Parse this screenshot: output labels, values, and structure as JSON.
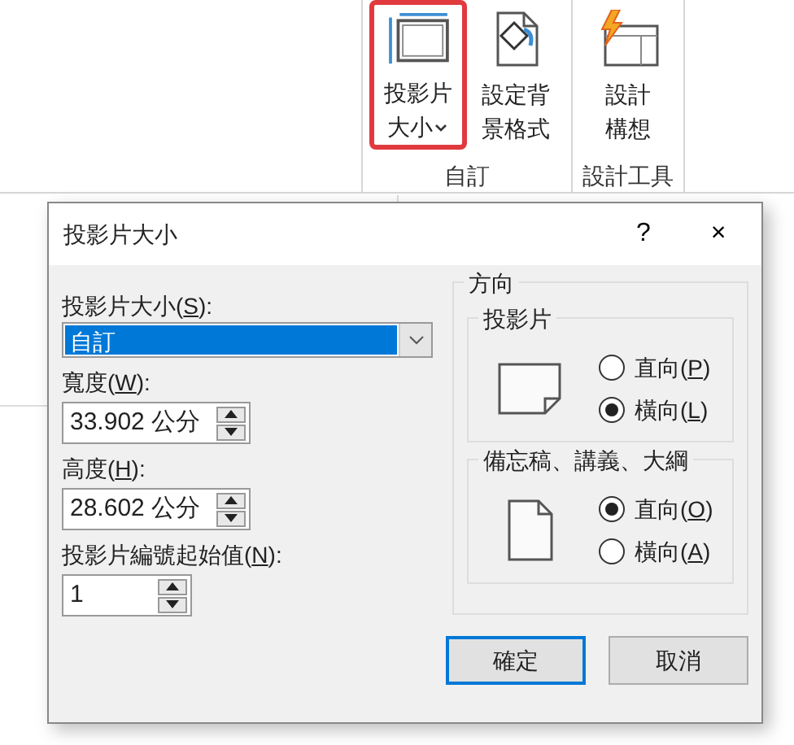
{
  "ribbon": {
    "groups": [
      {
        "label": "自訂",
        "buttons": [
          {
            "kind": "slide-size",
            "lines": [
              "投影片",
              "大小"
            ],
            "dropdown": true,
            "selected": true
          },
          {
            "kind": "background",
            "lines": [
              "設定背",
              "景格式"
            ],
            "dropdown": false,
            "selected": false
          }
        ]
      },
      {
        "label": "設計工具",
        "buttons": [
          {
            "kind": "designer",
            "lines": [
              "設計",
              "構想"
            ],
            "dropdown": false,
            "selected": false
          }
        ]
      }
    ]
  },
  "dialog": {
    "title": "投影片大小",
    "help": "?",
    "close": "×",
    "size": {
      "label": [
        "投影片大小(",
        "S",
        "):"
      ],
      "value": "自訂"
    },
    "width": {
      "label": [
        "寬度(",
        "W",
        "):"
      ],
      "value": "33.902 公分"
    },
    "height": {
      "label": [
        "高度(",
        "H",
        "):"
      ],
      "value": "28.602 公分"
    },
    "start": {
      "label": [
        "投影片編號起始值(",
        "N",
        "):"
      ],
      "value": "1"
    },
    "orientation": {
      "title": "方向",
      "groups": [
        {
          "title": "投影片",
          "kind": "landscape",
          "options": [
            {
              "label": [
                "直向(",
                "P",
                ")"
              ],
              "selected": false
            },
            {
              "label": [
                "橫向(",
                "L",
                ")"
              ],
              "selected": true
            }
          ]
        },
        {
          "title": "備忘稿、講義、大綱",
          "kind": "portrait",
          "options": [
            {
              "label": [
                "直向(",
                "O",
                ")"
              ],
              "selected": true
            },
            {
              "label": [
                "橫向(",
                "A",
                ")"
              ],
              "selected": false
            }
          ]
        }
      ]
    },
    "buttons": [
      {
        "label": "確定",
        "default": true
      },
      {
        "label": "取消",
        "default": false
      }
    ]
  }
}
